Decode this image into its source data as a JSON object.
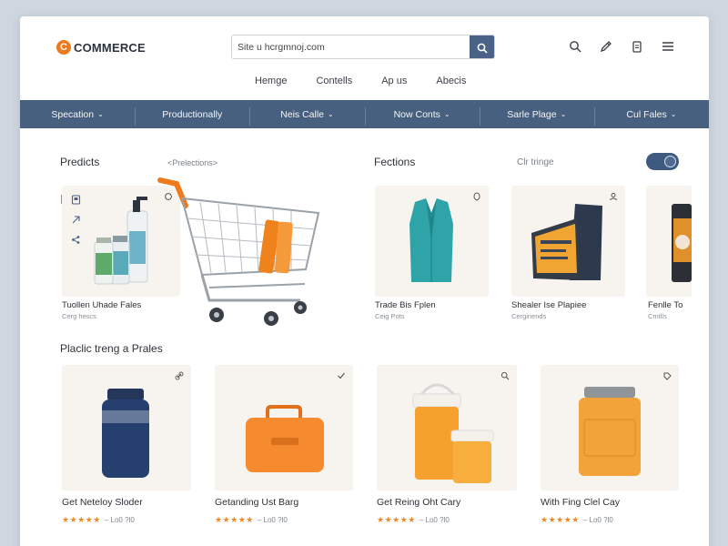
{
  "logo": {
    "mark": "C",
    "text": "COMMERCE"
  },
  "search": {
    "value": "Site u hcrgmnoj.com"
  },
  "subnav": [
    "Hemge",
    "Contells",
    "Ap us",
    "Abecis"
  ],
  "categories": [
    {
      "label": "Specation",
      "chevron": true
    },
    {
      "label": "Productionally",
      "chevron": false
    },
    {
      "label": "Neis Calle",
      "chevron": true
    },
    {
      "label": "Now Conts",
      "chevron": true
    },
    {
      "label": "Sarle Plage",
      "chevron": true
    },
    {
      "label": "Cul Fales",
      "chevron": true
    }
  ],
  "sections": {
    "products": {
      "title": "Predicts",
      "subtitle": "<Prelections>"
    },
    "fections": {
      "title": "Fections",
      "subtitle": "Clr tringe"
    },
    "practice": {
      "title": "Placlic treng a Prales"
    }
  },
  "top_products": [
    {
      "name": "Tuollen Uhade Fales",
      "meta": "Cerg hescs"
    },
    {
      "name": "Trade Bis Fplen",
      "meta": "Ceig Pots"
    },
    {
      "name": "Shealer Ise Plapiee",
      "meta": "Cerginends"
    },
    {
      "name": "Fenlle To",
      "meta": "Cmtlls"
    }
  ],
  "bottom_products": [
    {
      "name": "Get Neteloy Sloder",
      "price": "– Lo0 ?l0",
      "stars": "★★★★★"
    },
    {
      "name": "Getanding Ust Barg",
      "price": "– Lo0 ?l0",
      "stars": "★★★★★"
    },
    {
      "name": "Get Reing Oht Cary",
      "price": "– Lo0 ?l0",
      "stars": "★★★★★"
    },
    {
      "name": "With Fing Clel Cay",
      "price": "– Lo0 ?l0",
      "stars": "★★★★★"
    }
  ],
  "colors": {
    "accent": "#ee7a1e",
    "navbar": "#48607f",
    "card_bg": "#f7f4ef"
  }
}
